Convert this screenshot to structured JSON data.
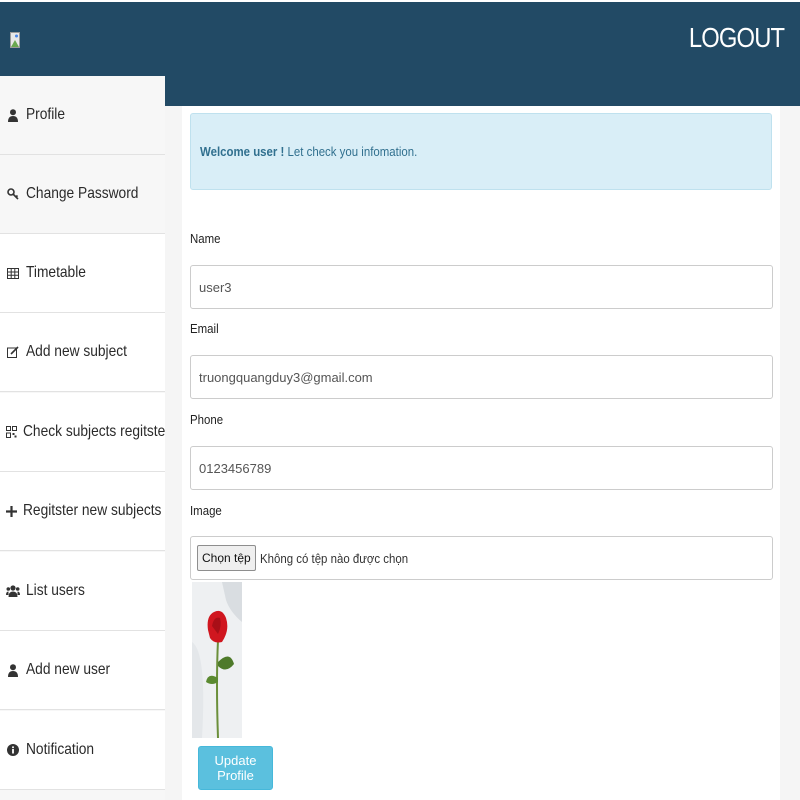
{
  "header": {
    "logout_label": "LOGOUT"
  },
  "sidebar": {
    "items": [
      {
        "icon": "user-icon",
        "label": "Profile"
      },
      {
        "icon": "key-icon",
        "label": "Change Password"
      },
      {
        "icon": "table-icon",
        "label": "Timetable"
      },
      {
        "icon": "edit-icon",
        "label": "Add new subject"
      },
      {
        "icon": "qrcode-icon",
        "label": "Check subjects regitsted"
      },
      {
        "icon": "plus-icon",
        "label": "Regitster new subjects"
      },
      {
        "icon": "users-icon",
        "label": "List users"
      },
      {
        "icon": "user-icon",
        "label": "Add new user"
      },
      {
        "icon": "info-icon",
        "label": "Notification"
      }
    ]
  },
  "alert": {
    "strong": "Welcome user !",
    "text": " Let check you infomation."
  },
  "form": {
    "name_label": "Name",
    "name_value": "user3",
    "email_label": "Email",
    "email_value": "truongquangduy3@gmail.com",
    "phone_label": "Phone",
    "phone_value": "0123456789",
    "image_label": "Image",
    "file_button": "Chọn tệp",
    "file_status": "Không có tệp nào được chọn",
    "submit_label": "Update Profile"
  },
  "colors": {
    "header_bg": "#224a65",
    "alert_bg": "#d9eef7",
    "button_bg": "#5bc0de"
  }
}
